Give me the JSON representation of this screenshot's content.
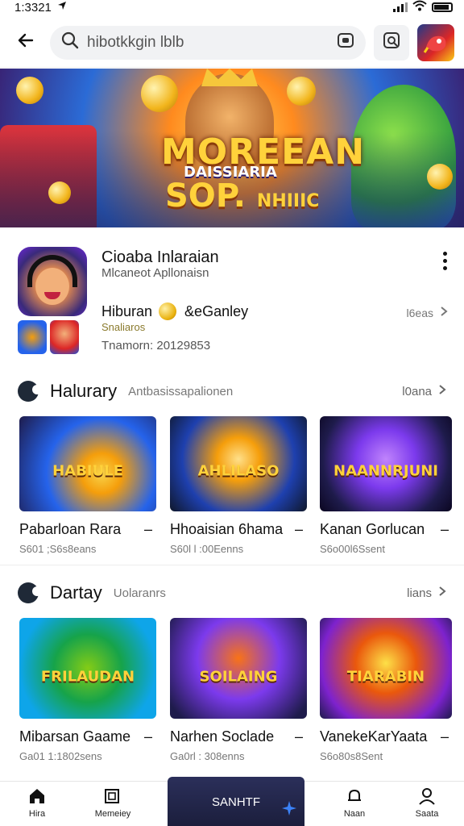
{
  "status_bar": {
    "time": "1:3321"
  },
  "search": {
    "value": "hibotkkgin lblb"
  },
  "banner": {
    "title_line1": "MOREEAN",
    "title_line2": "DAISSIARIA",
    "title_line3": "SOP.",
    "title_line3b": "NHIIIC"
  },
  "app": {
    "name": "Cioaba Inlaraian",
    "developer": "Mlcaneot Apllonaisn",
    "tag_left": "Hiburan",
    "tag_right": "&eGanley",
    "meta_small": "Snaliaros",
    "meta_version": "Tnamorn: 20129853",
    "side_link": "l6eas"
  },
  "section1": {
    "title": "Halurary",
    "subtitle": "Antbasissapalionen",
    "link": "l0ana",
    "cards": [
      {
        "title": "Pabarloan Rara",
        "subtitle": "S601 ;S6s8eans",
        "thumb_label": "HABIULE"
      },
      {
        "title": "Hhoaisian 6hama",
        "subtitle": "S60l l :00Eenns",
        "thumb_label": "AHLILASO"
      },
      {
        "title": "Kanan Gorlucan",
        "subtitle": "S6o00l6Ssent",
        "thumb_label": "NAANNRJUNI"
      }
    ]
  },
  "section2": {
    "title": "Dartay",
    "subtitle": "Uolaranrs",
    "link": "lians",
    "cards": [
      {
        "title": "Mibarsan Gaame",
        "subtitle": "Ga01 1:1802sens",
        "thumb_label": "FRILAUDAN"
      },
      {
        "title": "Narhen Soclade",
        "subtitle": "Ga0rl : 308enns",
        "thumb_label": "SOILAING"
      },
      {
        "title": "VanekeKarYaata",
        "subtitle": "S6o80s8Sent",
        "thumb_label": "TIARABIN"
      }
    ]
  },
  "bottom_nav": {
    "home": "Hira",
    "second": "Memeiey",
    "center": "SANHTF",
    "fourth": "Naan",
    "fifth": "Saata"
  }
}
